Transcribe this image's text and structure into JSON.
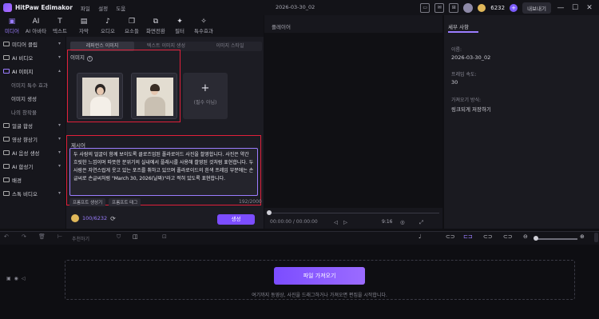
{
  "titlebar": {
    "app_name": "HitPaw Edimakor",
    "menu": [
      "파일",
      "설정",
      "도움"
    ],
    "project_name": "2026-03-30_02",
    "credits": "6232",
    "export_label": "내보내기"
  },
  "toolbar": {
    "tools": [
      "미디어",
      "AI 아바타",
      "텍스트",
      "자막",
      "오디오",
      "요소들",
      "화면전환",
      "필터",
      "특수효과"
    ]
  },
  "sidebar": {
    "items": [
      "미디어 클립",
      "AI 비디오",
      "AI 이미지",
      "이미지 특수 효과",
      "이미지 생성",
      "나의 창작물",
      "얼굴 합성",
      "영상 향상기",
      "AI 음성 생성",
      "AI 합성기",
      "배경",
      "스톡 비디오"
    ]
  },
  "panel": {
    "tabs": [
      "레퍼런스 이미지",
      "텍스트 이미지 생성",
      "이미지 스타일"
    ],
    "image_label": "이미지",
    "add_label": "(필수 아님)",
    "prompt_label": "제시어",
    "prompt_text": "두 사람의 얼굴이 함께 보이도록 클로즈업된 폴라로이드 사진을 촬영합니다. 사진은 약간 흐릿한 느낌이며 따뜻한 분위기의 실내에서 플래시를 사용해 촬영된 것처럼 표현합니다. 두 사람은 자연스럽게 웃고 있는 포즈를 취하고 있으며 폴라로이드의 흰색 프레임 부분에는 손글씨로 손글씨처럼 \"March 30, 2026(날짜)\"라고 적혀 있도록 표현합니다.",
    "chip_gen": "프롬프트 생성기",
    "chip_tag": "프롬프트 태그",
    "char_count": "192/2000",
    "credits": "100/6232",
    "generate": "생성"
  },
  "player": {
    "title": "플레이어",
    "timecode": "00:00:00 / 00:00:00",
    "ratio": "9:16"
  },
  "props": {
    "tab": "세부 사항",
    "name_label": "이름:",
    "name_value": "2026-03-30_02",
    "fps_label": "프레임 속도:",
    "fps_value": "30",
    "save_label": "가져오기 방식:",
    "save_value": "링크되게 저장하기"
  },
  "timeline": {
    "label": "추천하기",
    "import": "파일 가져오기",
    "hint": "여기까지 동영상, 사진을 드래그하거나 가져오면 편집을 시작합니다."
  },
  "colors": {
    "accent": "#9b7dff",
    "highlight_border": "#e0203a",
    "button": "#7c4dff"
  }
}
